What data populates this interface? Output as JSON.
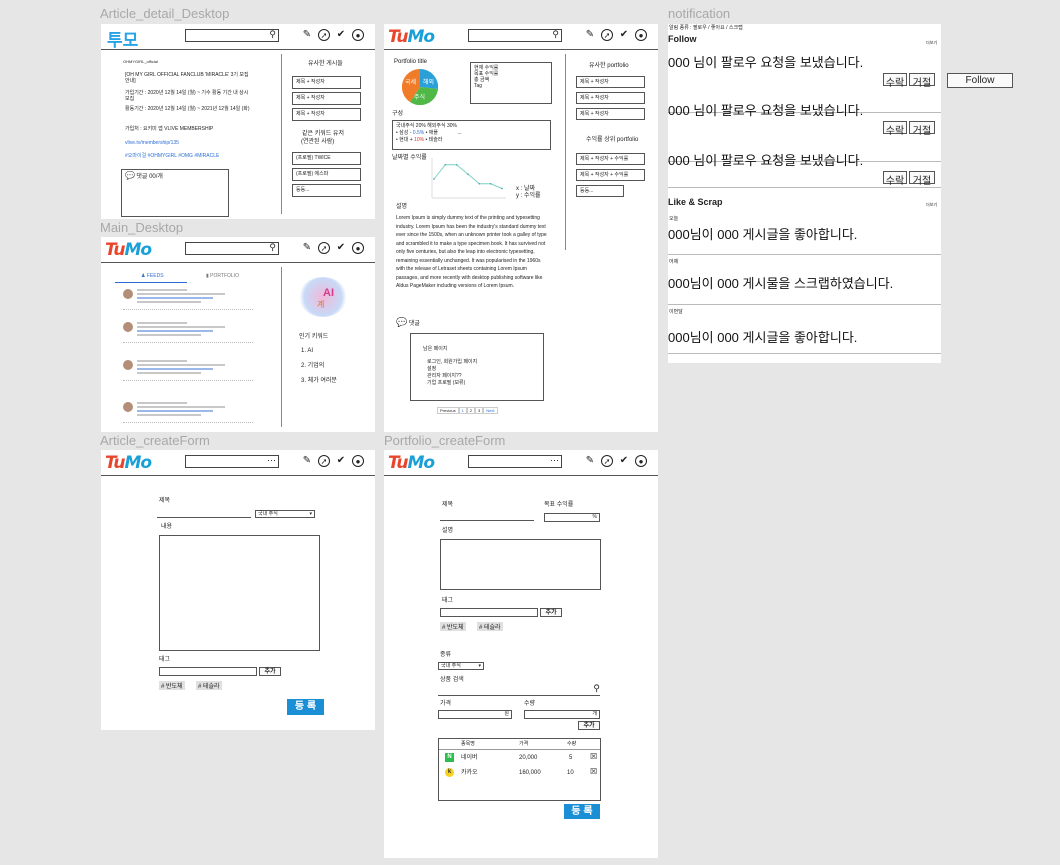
{
  "frames": {
    "article_detail": "Article_detail_Desktop",
    "main": "Main_Desktop",
    "article_create": "Article_createForm",
    "portfolio_create": "Portfolio_createForm",
    "notification": "notification"
  },
  "logo": {
    "text_a": "Tu",
    "text_b": "Mo",
    "korean": "투모"
  },
  "article_detail": {
    "author": "OHMYGIRL_official",
    "title": "[OH MY GIRL OFFICIAL FANCLUB 'MIRACLE' 3기 모집 안내]",
    "line1": "가입기간 : 2020년 12월 14일 (월) ~ 기수 활동 기간 내 상시 모집",
    "line2": "활동기간 : 2020년 12월 14일 (월) ~ 2021년 12월 14일 (화)",
    "line3": "가입처 : 요키미 앱 VLIVE MEMBERSHIP",
    "link": "vlive.tv/membership/135",
    "hashtags": "#오마이걸 #OHMYGIRL #OMG #MIRACLE",
    "comment": "댓글 00/개",
    "similar_title": "유사한 게시들",
    "similar": [
      "제목 + 작성자",
      "제목 + 작성자",
      "제목 + 작성자"
    ],
    "keyword_title": "같은 키워드 유저",
    "keyword_sub": "(연관된 사람)",
    "users": [
      "(프로필) TWICE",
      "(프로필) 에스파",
      "등등..."
    ]
  },
  "portfolio": {
    "title": "Portfolio title",
    "pie_labels": [
      "국세",
      "해외",
      "주식"
    ],
    "info": [
      "현재 수익률",
      "목표 수익률",
      "총 금액",
      "Tag"
    ],
    "composition": "구성",
    "comp_line1": "국내주식 20%   해외주식 30%",
    "comp_line2a": "• 삼성 - ",
    "comp_line2b": "0.5%",
    "comp_line2c": "  • 애플",
    "comp_line3a": "• 현대 + ",
    "comp_line3b": "10%",
    "comp_line3c": "  • 테슬라",
    "dots": "...",
    "chart_title": "날짜별 수익률",
    "x_label": "x : 날짜",
    "y_label": "y : 수익률",
    "desc_title": "설명",
    "desc": "Lorem Ipsum is simply dummy text of the printing and typesetting industry. Lorem Ipsum has been the industry's standard dummy text ever since the 1500s, when an unknown printer took a galley of type and scrambled it to make a type specimen book. It has survived not only five centuries, but also the leap into electronic typesetting, remaining essentially unchanged. It was popularised in the 1960s with the release of Letraset sheets containing Lorem Ipsum passages, and more recently with desktop publishing software like Aldus PageMaker including versions of Lorem Ipsum.",
    "comment": "댓글",
    "remaining_title": "남은 페이지",
    "remaining": [
      "로그인, 회원가입 페이지",
      "설정",
      "관리자 페이지??",
      "기업 프로필 (보류)"
    ],
    "pager": [
      "Previous",
      "1",
      "2",
      "3",
      "Next"
    ],
    "similar_title": "유사한 portfolio",
    "similar": [
      "제목 + 작성자",
      "제목 + 작성자",
      "제목 + 작성자"
    ],
    "top_title": "수익률 상위 portfolio",
    "top": [
      "제목 + 작성자 + 수익률",
      "제목 + 작성자 + 수익률",
      "등등..."
    ]
  },
  "chart_data": {
    "type": "line",
    "title": "날짜별 수익률",
    "xlabel": "x : 날짜",
    "ylabel": "y : 수익률",
    "series": [
      {
        "values": [
          8,
          14,
          14,
          10,
          6,
          6,
          4
        ]
      }
    ]
  },
  "main": {
    "tab_feeds": "FEEDS",
    "tab_portfolio": "PORTFOLIO",
    "keyword_title": "인기 키워드",
    "keywords": [
      "1. AI",
      "2. 기업의",
      "3. 체가 여러분"
    ],
    "cloud_words": [
      "AI",
      "계"
    ]
  },
  "article_create": {
    "title_label": "제목",
    "select": "국내 주식",
    "content_label": "내용",
    "tag_label": "태그",
    "add": "추가",
    "tags": [
      "# 반도체",
      "# 테슬라"
    ],
    "submit": "등 록"
  },
  "portfolio_create": {
    "title_label": "제목",
    "target_label": "목표 수익률",
    "percent": "%",
    "desc_label": "설명",
    "tag_label": "태그",
    "add": "추가",
    "tags": [
      "# 반도체",
      "# 테슬라"
    ],
    "kind_label": "종류",
    "kind_select": "국내 주식",
    "product_label": "상품 검색",
    "price_label": "가격",
    "qty_label": "수량",
    "won": "원",
    "unit": "개",
    "add2": "추가",
    "table_head": [
      "종목명",
      "가격",
      "수량"
    ],
    "rows": [
      {
        "icon": "N",
        "name": "네이버",
        "price": "20,000",
        "qty": "5"
      },
      {
        "icon": "k",
        "name": "카카오",
        "price": "160,000",
        "qty": "10"
      }
    ],
    "submit": "등 록"
  },
  "notification": {
    "kinds": "알림 종류 : 팔로우 / 좋아요 / 스크랩",
    "follow_title": "Follow",
    "more": "더보기",
    "follow_msgs": [
      "000 님이 팔로우 요청을 보냈습니다.",
      "000 님이 팔로우 요청을 보냈습니다.",
      "000 님이 팔로우 요청을 보냈습니다."
    ],
    "accept": "수락",
    "reject": "거절",
    "follow_btn": "Follow",
    "like_title": "Like & Scrap",
    "like_items": [
      {
        "when": "오늘",
        "msg": "000님이 000 게시글을 좋아합니다."
      },
      {
        "when": "어제",
        "msg": "000님이 000 게시물을 스크랩하였습니다."
      },
      {
        "when": "이번달",
        "msg": "000님이 000 게시글을 좋아합니다."
      }
    ]
  }
}
